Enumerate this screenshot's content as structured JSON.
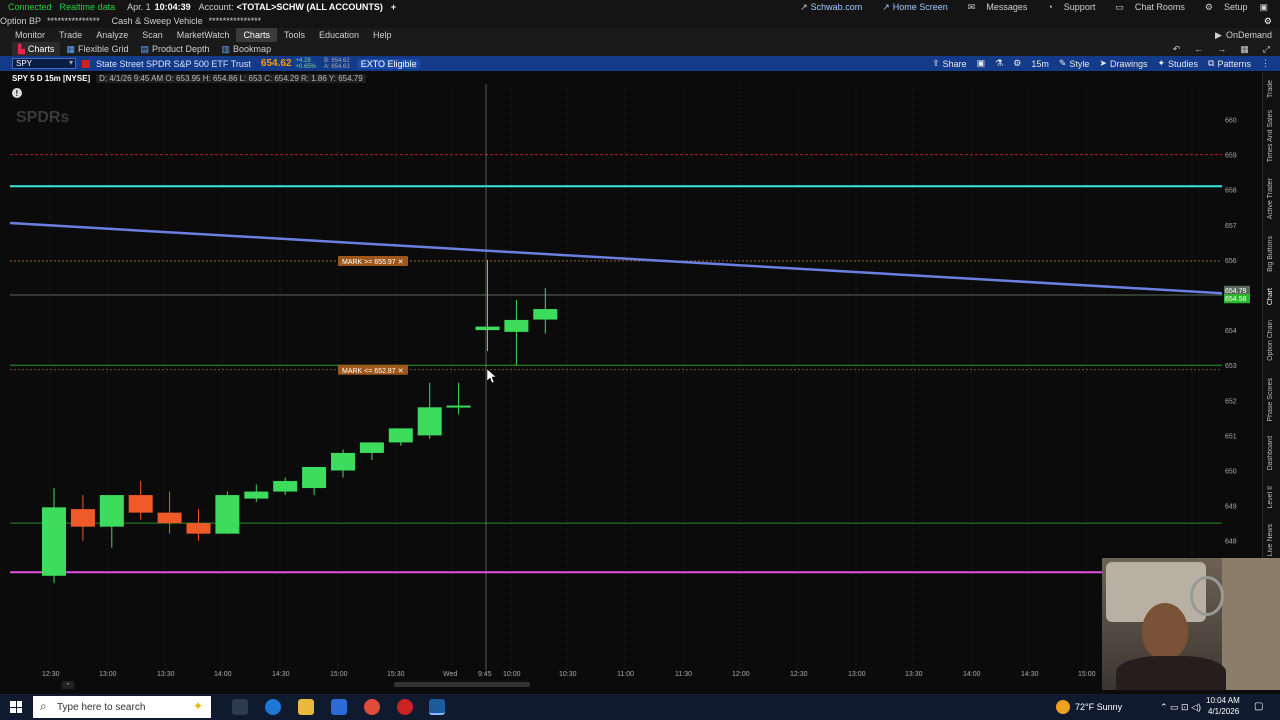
{
  "status": {
    "connected": "Connected",
    "realtime": "Realtime data",
    "date": "Apr. 1",
    "time": "10:04:39",
    "account_label": "Account:",
    "account_value": "<TOTAL>SCHW (ALL ACCOUNTS)",
    "right_items": [
      "Schwab.com",
      "Home Screen",
      "Messages",
      "Support",
      "Chat Rooms",
      "Setup"
    ]
  },
  "status2": {
    "option_bp_label": "Option BP",
    "option_bp_value": "***************",
    "cash_label": "Cash & Sweep Vehicle",
    "cash_value": "***************",
    "ondemand": "OnDemand"
  },
  "menu": [
    "Monitor",
    "Trade",
    "Analyze",
    "Scan",
    "MarketWatch",
    "Charts",
    "Tools",
    "Education",
    "Help"
  ],
  "tabs": [
    "Charts",
    "Flexible Grid",
    "Product Depth",
    "Bookmap"
  ],
  "symbolbar": {
    "symbol": "SPY",
    "name": "State Street SPDR S&P 500 ETF Trust",
    "price": "654.62",
    "change_top": "+4.28",
    "change_bottom": "+0.65%",
    "bid": "B: 654.62",
    "ask": "A: 654.63",
    "exto": "EXTO Eligible",
    "buttons": [
      "Share",
      "15m",
      "Style",
      "Drawings",
      "Studies",
      "Patterns"
    ]
  },
  "chartinfo": {
    "title": "SPY 5 D 15m [NYSE]",
    "ohlc": "D: 4/1/26 9:45 AM   O: 653.95   H: 654.86   L: 653   C: 654.29   R: 1.86   Y: 654.79"
  },
  "watermark": "SPDRs",
  "chart_data": {
    "type": "candlestick",
    "y_axis": {
      "min": 647,
      "max": 660.5,
      "ticks": [
        648,
        649,
        650,
        651,
        652,
        653,
        654,
        655,
        656,
        657,
        658,
        659,
        660
      ]
    },
    "x_ticks": [
      "12:30",
      "13:00",
      "13:30",
      "14:00",
      "14:30",
      "15:00",
      "15:30",
      "Wed",
      "9:45",
      "10:00",
      "10:30",
      "11:00",
      "11:30",
      "12:00",
      "12:30",
      "13:00",
      "13:30",
      "14:00",
      "14:30",
      "15:00"
    ],
    "current_price_box": "654.79",
    "current_price_box2": "654.58",
    "alerts": [
      {
        "label": "MARK >= 655.97",
        "price": 655.97
      },
      {
        "label": "MARK <= 652.87",
        "price": 652.87
      }
    ],
    "hlines": [
      {
        "price": 658.1,
        "color": "#39e6e6"
      },
      {
        "price": 659.0,
        "color": "#b22222"
      },
      {
        "price": 655.0,
        "color": "#5a6b5a"
      },
      {
        "price": 653.0,
        "color": "#2a9d2a"
      },
      {
        "price": 648.5,
        "color": "#2a8a2a"
      },
      {
        "price": 647.1,
        "color": "#e64fe6"
      }
    ],
    "trendline": {
      "price_start": 657.05,
      "price_end": 655.05,
      "color": "#6b7fe0"
    },
    "candles": [
      {
        "slot": 0,
        "open": 647.0,
        "high": 649.5,
        "low": 646.8,
        "close": 648.95
      },
      {
        "slot": 1,
        "open": 648.9,
        "high": 649.3,
        "low": 648.0,
        "close": 648.4
      },
      {
        "slot": 2,
        "open": 648.4,
        "high": 649.0,
        "low": 647.8,
        "close": 649.3
      },
      {
        "slot": 3,
        "open": 649.3,
        "high": 649.7,
        "low": 648.6,
        "close": 648.8
      },
      {
        "slot": 4,
        "open": 648.8,
        "high": 649.4,
        "low": 648.2,
        "close": 648.5
      },
      {
        "slot": 5,
        "open": 648.5,
        "high": 648.9,
        "low": 648.0,
        "close": 648.2
      },
      {
        "slot": 6,
        "open": 648.2,
        "high": 649.4,
        "low": 648.2,
        "close": 649.3
      },
      {
        "slot": 7,
        "open": 649.2,
        "high": 649.6,
        "low": 649.1,
        "close": 649.4
      },
      {
        "slot": 8,
        "open": 649.4,
        "high": 649.8,
        "low": 649.3,
        "close": 649.7
      },
      {
        "slot": 9,
        "open": 649.5,
        "high": 650.0,
        "low": 649.3,
        "close": 650.1
      },
      {
        "slot": 10,
        "open": 650.0,
        "high": 650.6,
        "low": 649.8,
        "close": 650.5
      },
      {
        "slot": 11,
        "open": 650.5,
        "high": 650.8,
        "low": 650.3,
        "close": 650.8
      },
      {
        "slot": 12,
        "open": 650.8,
        "high": 651.2,
        "low": 650.7,
        "close": 651.2
      },
      {
        "slot": 13,
        "open": 651.0,
        "high": 652.5,
        "low": 650.9,
        "close": 651.8
      },
      {
        "slot": 14,
        "open": 651.8,
        "high": 652.5,
        "low": 651.6,
        "close": 651.85
      },
      {
        "slot": 15,
        "open": 654.0,
        "high": 656.0,
        "low": 653.4,
        "close": 654.1
      },
      {
        "slot": 16,
        "open": 653.95,
        "high": 654.86,
        "low": 653.0,
        "close": 654.29
      },
      {
        "slot": 17,
        "open": 654.3,
        "high": 655.2,
        "low": 653.9,
        "close": 654.6
      }
    ]
  },
  "rightpanel": [
    "Trade",
    "Times And Sales",
    "Active Trader",
    "Big Buttons",
    "Chart",
    "Option Chain",
    "Phase Scores",
    "Dashboard",
    "Level II",
    "Live News"
  ],
  "taskbar": {
    "search_placeholder": "Type here to search",
    "weather": "72°F  Sunny",
    "time": "10:04 AM",
    "date": "4/1/2026"
  }
}
